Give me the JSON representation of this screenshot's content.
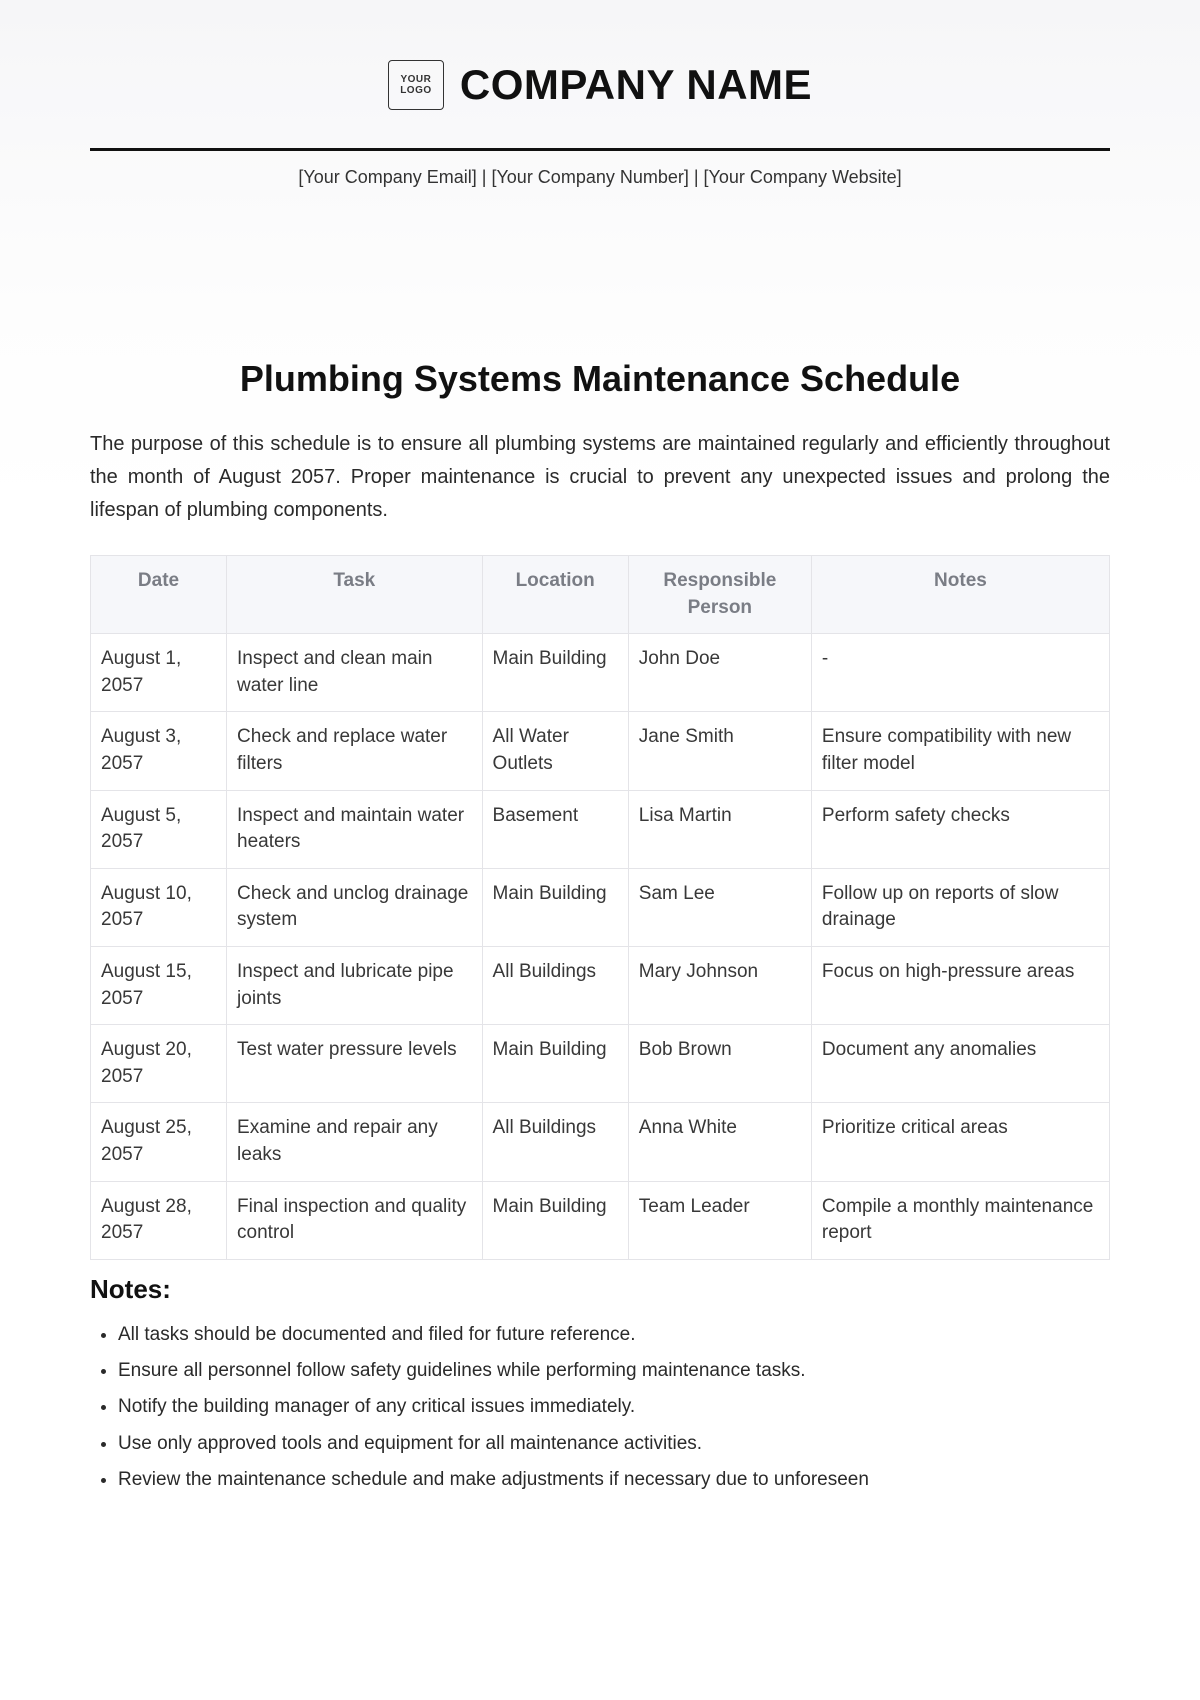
{
  "header": {
    "logo_text": "YOUR\nLOGO",
    "company_name": "COMPANY NAME",
    "contact_line": "[Your Company Email] | [Your Company Number] | [Your Company Website]"
  },
  "title": "Plumbing Systems Maintenance Schedule",
  "intro": "The purpose of this schedule is to ensure all plumbing systems are maintained regularly and efficiently throughout the month of August 2057. Proper maintenance is crucial to prevent any unexpected issues and prolong the lifespan of plumbing components.",
  "table": {
    "headers": [
      "Date",
      "Task",
      "Location",
      "Responsible Person",
      "Notes"
    ],
    "rows": [
      {
        "date": "August 1, 2057",
        "task": "Inspect and clean main water line",
        "location": "Main Building",
        "person": "John Doe",
        "notes": "-"
      },
      {
        "date": "August 3, 2057",
        "task": "Check and replace water filters",
        "location": "All Water Outlets",
        "person": "Jane Smith",
        "notes": "Ensure compatibility with new filter model"
      },
      {
        "date": "August 5, 2057",
        "task": "Inspect and maintain water heaters",
        "location": "Basement",
        "person": "Lisa Martin",
        "notes": "Perform safety checks"
      },
      {
        "date": "August 10, 2057",
        "task": "Check and unclog drainage system",
        "location": "Main Building",
        "person": "Sam Lee",
        "notes": "Follow up on reports of slow drainage"
      },
      {
        "date": "August 15, 2057",
        "task": "Inspect and lubricate pipe joints",
        "location": "All Buildings",
        "person": "Mary Johnson",
        "notes": "Focus on high-pressure areas"
      },
      {
        "date": "August 20, 2057",
        "task": "Test water pressure levels",
        "location": "Main Building",
        "person": "Bob Brown",
        "notes": "Document any anomalies"
      },
      {
        "date": "August 25, 2057",
        "task": "Examine and repair any leaks",
        "location": "All Buildings",
        "person": "Anna White",
        "notes": "Prioritize critical areas"
      },
      {
        "date": "August 28, 2057",
        "task": "Final inspection and quality control",
        "location": "Main Building",
        "person": "Team Leader",
        "notes": "Compile a monthly maintenance report"
      }
    ]
  },
  "notes_section": {
    "heading": "Notes:",
    "items": [
      "All tasks should be documented and filed for future reference.",
      "Ensure all personnel follow safety guidelines while performing maintenance tasks.",
      "Notify the building manager of any critical issues immediately.",
      "Use only approved tools and equipment for all maintenance activities.",
      "Review the maintenance schedule and make adjustments if necessary due to unforeseen"
    ]
  }
}
